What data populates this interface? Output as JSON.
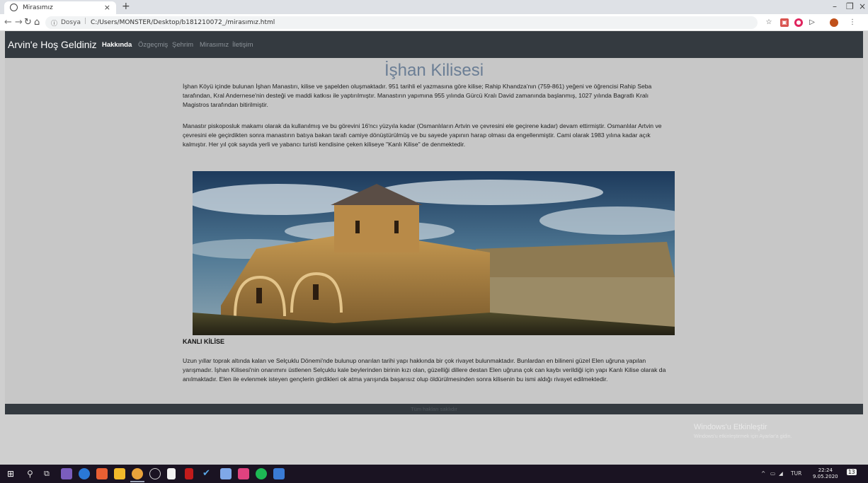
{
  "browser": {
    "tab_title": "Mirasımız",
    "new_tab": "+",
    "tab_close": "×",
    "window_controls": [
      "–",
      "❐",
      "×"
    ],
    "address_label": "Dosya",
    "url": "C:/Users/MONSTER/Desktop/b181210072_/mirasımız.html",
    "icons": [
      "back-icon",
      "forward-icon",
      "reload-icon",
      "home-icon",
      "info-icon",
      "star-icon",
      "extension-icon",
      "profile-icon",
      "menu-icon"
    ]
  },
  "nav": {
    "brand": "Arvin'e Hoş Geldiniz",
    "links": [
      "Hakkında",
      "Özgeçmiş",
      "Şehrim",
      "Mirasımız",
      "İletişim"
    ]
  },
  "page": {
    "title": "İşhan Kilisesi",
    "paragraphs": [
      "İşhan Köyü içinde bulunan İşhan Manastırı, kilise ve şapelden oluşmaktadır. 951 tarihli el yazmasına göre kilise; Rahip Khandza'nın (759-861) yeğeni ve öğrencisi Rahip Seba tarafından, Kral Andernese'nin desteği ve maddi katkısı ile yaptırılmıştır. Manastırın yapımına 955 yılında Gürcü Kralı David zamanında başlanmış, 1027 yılında Bagratlı Kralı Magistros tarafından bitirilmiştir.",
      "Manastır piskoposluk makamı olarak da kullanılmış ve bu görevini 16'ncı yüzyıla kadar (Osmanlıların Artvin ve çevresini ele geçirene kadar) devam ettirmiştir. Osmanlılar Artvin ve çevresini ele geçirdikten sonra manastırın batıya bakan tarafı camiye dönüştürülmüş ve bu sayede yapının harap olması da engellenmiştir. Cami olarak 1983 yılına kadar açık kalmıştır. Her yıl çok sayıda yerli ve yabancı turisti kendisine çeken kiliseye \"Kanlı Kilise\" de denmektedir."
    ],
    "subheading": "KANLI KİLİSE",
    "paragraph3": "Uzun yıllar toprak altında kalan ve Selçuklu Dönemi'nde bulunup onarılan tarihi yapı hakkında bir çok rivayet bulunmaktadır. Bunlardan en bilineni güzel Elen uğruna yapılan yarışmadır. İşhan Kilisesi'nin onarımını üstlenen Selçuklu kale beylerinden birinin kızı olan, güzelliği dillere destan Elen uğruna çok can kaybı verildiği için yapı Kanlı Kilise olarak da anılmaktadır. Elen ile evlenmek isteyen gençlerin girdikleri ok atma yarışında başarısız olup öldürülmesinden sonra kilisenin bu ismi aldığı rivayet edilmektedir.",
    "footer": "Tüm hakları saklıdır"
  },
  "windows": {
    "watermark_title": "Windows'u Etkinleştir",
    "watermark_sub": "Windows'u etkinleştirmek için Ayarlar'a gidin.",
    "lang": "TUR",
    "time": "22:24",
    "date": "9.05.2020",
    "notif_count": "13"
  },
  "colors": {
    "navbar": "#343a40",
    "title": "#6b7e95",
    "content_bg": "#c7c7c7",
    "taskbar": "#1a1322"
  }
}
